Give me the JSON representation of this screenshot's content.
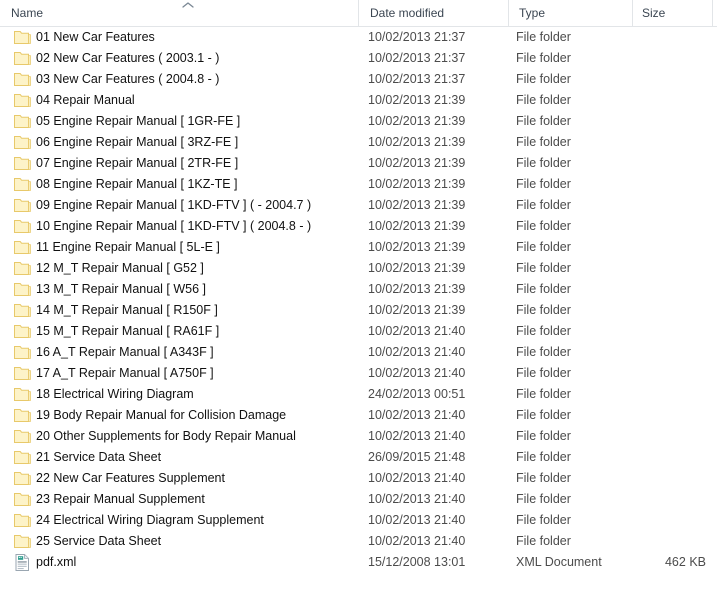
{
  "window": {
    "view": "details"
  },
  "columns": {
    "name": {
      "label": "Name",
      "sort": "ascending",
      "sort_icon": "chevron-up-icon"
    },
    "date_modified": {
      "label": "Date modified"
    },
    "type": {
      "label": "Type"
    },
    "size": {
      "label": "Size"
    }
  },
  "rows": [
    {
      "icon": "folder-icon",
      "name": "01 New Car Features",
      "date": "10/02/2013 21:37",
      "type": "File folder",
      "size": ""
    },
    {
      "icon": "folder-icon",
      "name": "02 New Car Features ( 2003.1 - )",
      "date": "10/02/2013 21:37",
      "type": "File folder",
      "size": ""
    },
    {
      "icon": "folder-icon",
      "name": "03 New Car Features ( 2004.8 - )",
      "date": "10/02/2013 21:37",
      "type": "File folder",
      "size": ""
    },
    {
      "icon": "folder-icon",
      "name": "04 Repair Manual",
      "date": "10/02/2013 21:39",
      "type": "File folder",
      "size": ""
    },
    {
      "icon": "folder-icon",
      "name": "05 Engine Repair Manual [ 1GR-FE ]",
      "date": "10/02/2013 21:39",
      "type": "File folder",
      "size": ""
    },
    {
      "icon": "folder-icon",
      "name": "06 Engine Repair Manual [ 3RZ-FE ]",
      "date": "10/02/2013 21:39",
      "type": "File folder",
      "size": ""
    },
    {
      "icon": "folder-icon",
      "name": "07 Engine Repair Manual [ 2TR-FE ]",
      "date": "10/02/2013 21:39",
      "type": "File folder",
      "size": ""
    },
    {
      "icon": "folder-icon",
      "name": "08 Engine Repair Manual [ 1KZ-TE ]",
      "date": "10/02/2013 21:39",
      "type": "File folder",
      "size": ""
    },
    {
      "icon": "folder-icon",
      "name": "09 Engine Repair Manual [ 1KD-FTV ] ( - 2004.7 )",
      "date": "10/02/2013 21:39",
      "type": "File folder",
      "size": ""
    },
    {
      "icon": "folder-icon",
      "name": "10 Engine Repair Manual [ 1KD-FTV ] ( 2004.8 - )",
      "date": "10/02/2013 21:39",
      "type": "File folder",
      "size": ""
    },
    {
      "icon": "folder-icon",
      "name": "11 Engine Repair Manual [ 5L-E ]",
      "date": "10/02/2013 21:39",
      "type": "File folder",
      "size": ""
    },
    {
      "icon": "folder-icon",
      "name": "12 M_T Repair Manual [ G52 ]",
      "date": "10/02/2013 21:39",
      "type": "File folder",
      "size": ""
    },
    {
      "icon": "folder-icon",
      "name": "13 M_T Repair Manual [ W56 ]",
      "date": "10/02/2013 21:39",
      "type": "File folder",
      "size": ""
    },
    {
      "icon": "folder-icon",
      "name": "14 M_T Repair Manual [ R150F ]",
      "date": "10/02/2013 21:39",
      "type": "File folder",
      "size": ""
    },
    {
      "icon": "folder-icon",
      "name": "15 M_T Repair Manual [ RA61F ]",
      "date": "10/02/2013 21:40",
      "type": "File folder",
      "size": ""
    },
    {
      "icon": "folder-icon",
      "name": "16 A_T Repair Manual [ A343F ]",
      "date": "10/02/2013 21:40",
      "type": "File folder",
      "size": ""
    },
    {
      "icon": "folder-icon",
      "name": "17 A_T Repair Manual [ A750F ]",
      "date": "10/02/2013 21:40",
      "type": "File folder",
      "size": ""
    },
    {
      "icon": "folder-icon",
      "name": "18 Electrical Wiring Diagram",
      "date": "24/02/2013 00:51",
      "type": "File folder",
      "size": ""
    },
    {
      "icon": "folder-icon",
      "name": "19 Body Repair Manual for Collision Damage",
      "date": "10/02/2013 21:40",
      "type": "File folder",
      "size": ""
    },
    {
      "icon": "folder-icon",
      "name": "20 Other Supplements for Body Repair Manual",
      "date": "10/02/2013 21:40",
      "type": "File folder",
      "size": ""
    },
    {
      "icon": "folder-icon",
      "name": "21 Service Data Sheet",
      "date": "26/09/2015 21:48",
      "type": "File folder",
      "size": ""
    },
    {
      "icon": "folder-icon",
      "name": "22 New Car Features Supplement",
      "date": "10/02/2013 21:40",
      "type": "File folder",
      "size": ""
    },
    {
      "icon": "folder-icon",
      "name": "23 Repair Manual Supplement",
      "date": "10/02/2013 21:40",
      "type": "File folder",
      "size": ""
    },
    {
      "icon": "folder-icon",
      "name": "24 Electrical Wiring Diagram Supplement",
      "date": "10/02/2013 21:40",
      "type": "File folder",
      "size": ""
    },
    {
      "icon": "folder-icon",
      "name": "25 Service Data Sheet",
      "date": "10/02/2013 21:40",
      "type": "File folder",
      "size": ""
    },
    {
      "icon": "xml-file-icon",
      "name": "pdf.xml",
      "date": "15/12/2008 13:01",
      "type": "XML Document",
      "size": "462 KB"
    }
  ],
  "colors": {
    "folder_fill": "#fdf3c8",
    "folder_stroke": "#e8c96a",
    "header_text": "#3b4652",
    "row_text": "#1f1f1f",
    "secondary_text": "#4c4c4c",
    "separator": "#e2e5e8",
    "background": "#ffffff"
  }
}
